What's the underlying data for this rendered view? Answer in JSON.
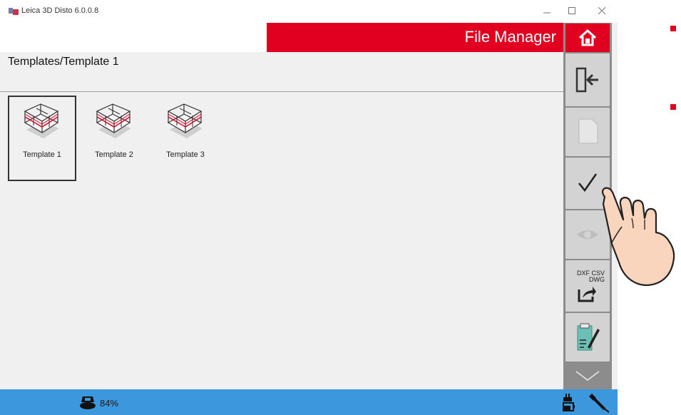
{
  "window": {
    "title": "Leica 3D Disto 6.0.0.8",
    "controls": [
      "minimize",
      "maximize",
      "close"
    ]
  },
  "header": {
    "title": "File Manager"
  },
  "breadcrumb": "Templates/Template 1",
  "templates": [
    {
      "label": "Template 1",
      "selected": true
    },
    {
      "label": "Template 2",
      "selected": false
    },
    {
      "label": "Template 3",
      "selected": false
    }
  ],
  "sidebar": {
    "buttons": [
      {
        "icon": "home-icon",
        "enabled": true
      },
      {
        "icon": "exit-door-icon",
        "enabled": true
      },
      {
        "icon": "new-file-icon",
        "enabled": false
      },
      {
        "icon": "checkmark-icon",
        "enabled": true
      },
      {
        "icon": "eye-icon",
        "enabled": false
      },
      {
        "icon": "export-icon",
        "enabled": true,
        "text_top": "DXF CSV",
        "text_bottom": "DWG"
      },
      {
        "icon": "edit-notes-icon",
        "enabled": true
      },
      {
        "icon": "chevron-down-icon",
        "enabled": true
      }
    ]
  },
  "status": {
    "battery_percent": "84%"
  },
  "colors": {
    "accent_red": "#e1001f",
    "status_blue": "#3d97dc",
    "sidebar_gray": "#8c8c8c"
  }
}
